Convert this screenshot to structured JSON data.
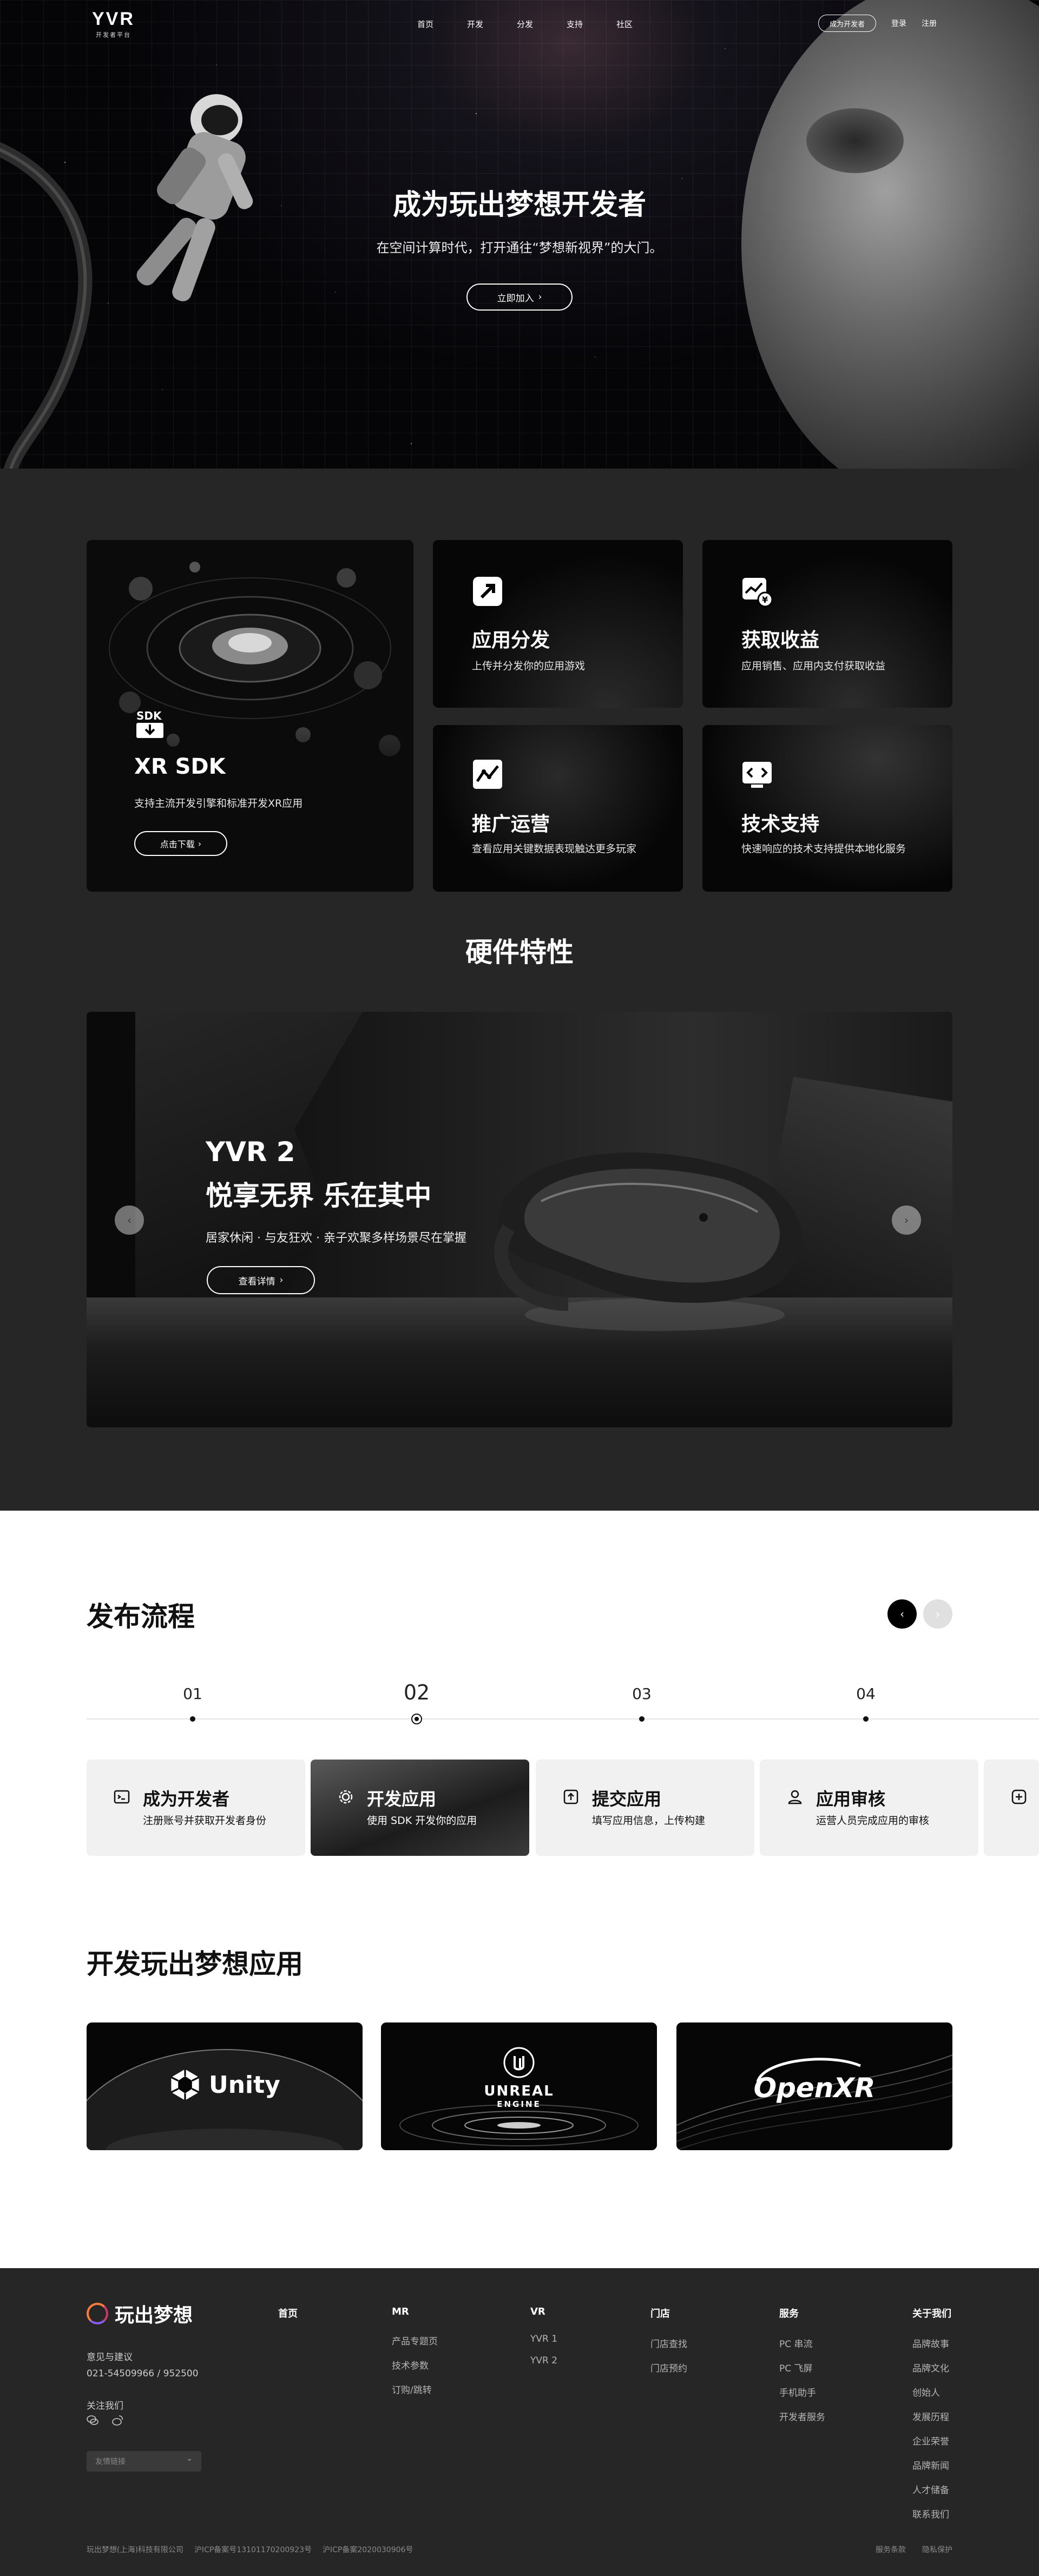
{
  "nav": {
    "logo_mark": "YVR",
    "logo_sub": "开发者平台",
    "links": [
      "首页",
      "开发",
      "分发",
      "支持",
      "社区"
    ],
    "become_dev": "成为开发者",
    "login": "登录",
    "register": "注册"
  },
  "hero": {
    "title": "成为玩出梦想开发者",
    "subtitle": "在空间计算时代，打开通往“梦想新视界”的大门。",
    "cta": "立即加入"
  },
  "features": {
    "sdk": {
      "icon_text": "SDK",
      "title": "XR SDK",
      "desc": "支持主流开发引擎和标准开发XR应用",
      "button": "点击下载"
    },
    "distribute": {
      "title": "应用分发",
      "desc": "上传并分发你的应用游戏"
    },
    "revenue": {
      "title": "获取收益",
      "desc": "应用销售、应用内支付获取收益"
    },
    "promote": {
      "title": "推广运营",
      "desc": "查看应用关键数据表现触达更多玩家"
    },
    "support": {
      "title": "技术支持",
      "desc": "快速响应的技术支持提供本地化服务"
    }
  },
  "hardware": {
    "title": "硬件特性",
    "product": "YVR 2",
    "slogan": "悦享无界 乐在其中",
    "desc": "居家休闲 · 与友狂欢 · 亲子欢聚多样场景尽在掌握",
    "button": "查看详情"
  },
  "process": {
    "title": "发布流程",
    "steps": [
      {
        "num": "01",
        "title": "成为开发者",
        "desc": "注册账号并获取开发者身份"
      },
      {
        "num": "02",
        "title": "开发应用",
        "desc": "使用 SDK 开发你的应用"
      },
      {
        "num": "03",
        "title": "提交应用",
        "desc": "填写应用信息，上传构建"
      },
      {
        "num": "04",
        "title": "应用审核",
        "desc": "运营人员完成应用的审核"
      }
    ]
  },
  "engines": {
    "title": "开发玩出梦想应用",
    "items": [
      "Unity",
      "UNREAL",
      "ENGINE",
      "OpenXR"
    ]
  },
  "footer": {
    "brand": "玩出梦想",
    "contact_label": "意见与建议",
    "phone": "021-54509966 / 952500",
    "follow": "关注我们",
    "lang_placeholder": "友情链接",
    "columns": [
      {
        "title": "首页",
        "items": []
      },
      {
        "title": "MR",
        "items": [
          "产品专题页",
          "技术参数",
          "订购/跳转"
        ]
      },
      {
        "title": "VR",
        "items": [
          "YVR 1",
          "YVR 2"
        ]
      },
      {
        "title": "门店",
        "items": [
          "门店查找",
          "门店预约"
        ]
      },
      {
        "title": "服务",
        "items": [
          "PC 串流",
          "PC 飞屏",
          "手机助手",
          "开发者服务"
        ]
      },
      {
        "title": "关于我们",
        "items": [
          "品牌故事",
          "品牌文化",
          "创始人",
          "发展历程",
          "企业荣誉",
          "品牌新闻",
          "人才储备",
          "联系我们"
        ]
      }
    ],
    "copyright": "玩出梦想(上海)科技有限公司",
    "icp": "沪ICP备案号13101170200923号",
    "police": "沪ICP备案2020030906号",
    "terms": "服务条款",
    "privacy": "隐私保护"
  },
  "colors": {
    "dark_bg": "#262626",
    "hero_bg": "#050508",
    "white_bg": "#ffffff",
    "card_light": "#f1f1f1"
  }
}
